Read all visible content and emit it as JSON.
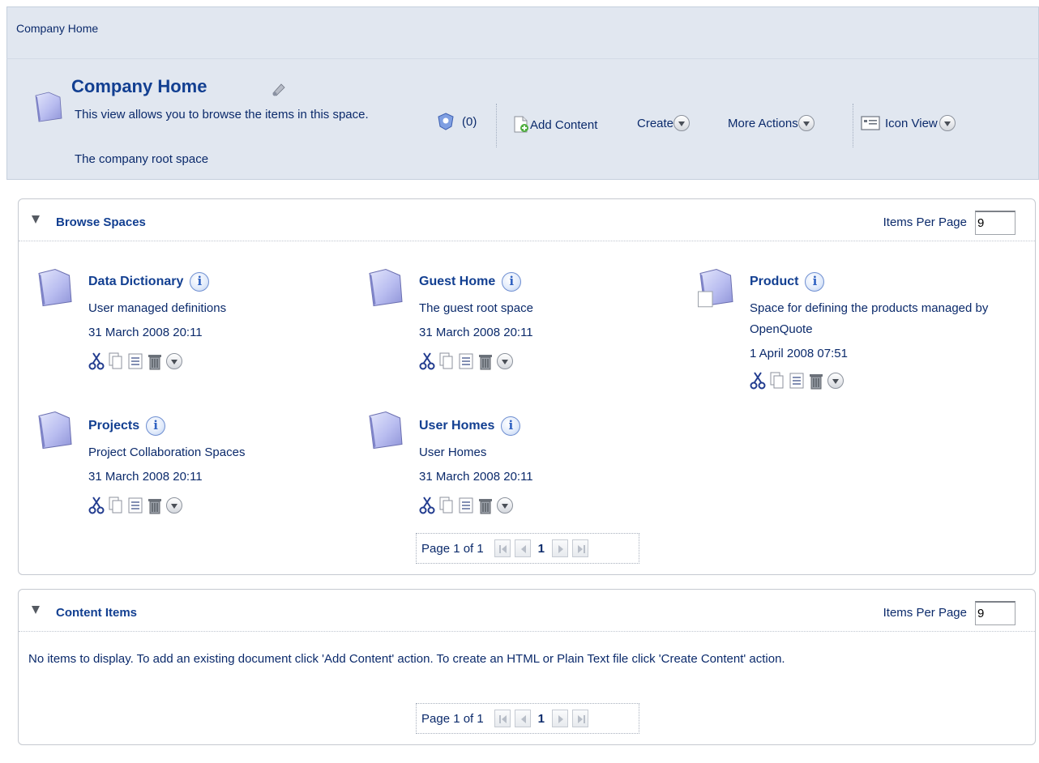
{
  "breadcrumb": "Company Home",
  "header": {
    "title": "Company Home",
    "description": "This view allows you to browse the items in this space.",
    "subtitle": "The company root space",
    "rules_count": "(0)",
    "add_content": "Add Content",
    "create": "Create",
    "more_actions": "More Actions",
    "icon_view": "Icon View"
  },
  "browse": {
    "title": "Browse Spaces",
    "items_per_page_label": "Items Per Page",
    "items_per_page_value": "9",
    "items": [
      {
        "name": "Data Dictionary",
        "description": "User managed definitions",
        "date": "31 March 2008 20:11"
      },
      {
        "name": "Guest Home",
        "description": "The guest root space",
        "date": "31 March 2008 20:11"
      },
      {
        "name": "Product",
        "description": "Space for defining the products managed by OpenQuote",
        "date": "1 April 2008 07:51"
      },
      {
        "name": "Projects",
        "description": "Project Collaboration Spaces",
        "date": "31 March 2008 20:11"
      },
      {
        "name": "User Homes",
        "description": "User Homes",
        "date": "31 March 2008 20:11"
      }
    ],
    "pager": {
      "label": "Page 1 of 1",
      "current": "1"
    }
  },
  "content": {
    "title": "Content Items",
    "items_per_page_label": "Items Per Page",
    "items_per_page_value": "9",
    "empty_message": "No items to display. To add an existing document click 'Add Content' action. To create an HTML or Plain Text file click 'Create Content' action.",
    "pager": {
      "label": "Page 1 of 1",
      "current": "1"
    }
  }
}
